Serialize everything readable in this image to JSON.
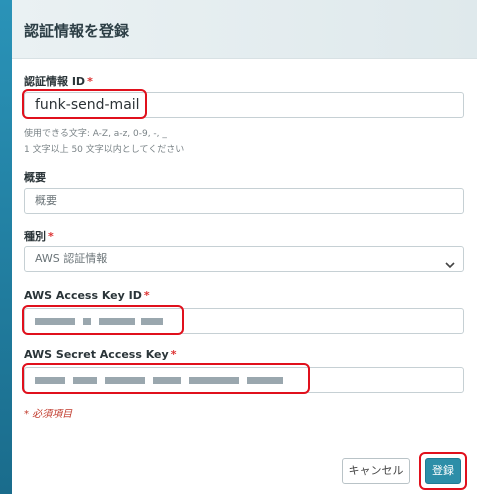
{
  "dialog": {
    "title": "認証情報を登録"
  },
  "credential_id": {
    "label": "認証情報 ID",
    "required_mark": "*",
    "value": "funk-send-mail",
    "hint_chars": "使用できる文字: A-Z, a-z, 0-9, -, _",
    "hint_length": "1 文字以上 50 文字以内としてください"
  },
  "summary": {
    "label": "概要",
    "placeholder": "概要"
  },
  "type": {
    "label": "種別",
    "required_mark": "*",
    "selected": "AWS 認証情報"
  },
  "access_key_id": {
    "label": "AWS Access Key ID",
    "required_mark": "*"
  },
  "secret_access_key": {
    "label": "AWS Secret Access Key",
    "required_mark": "*"
  },
  "required_note": "* 必須項目",
  "buttons": {
    "cancel": "キャンセル",
    "submit": "登録"
  },
  "icons": {
    "select_chevron": "chevron-down-icon"
  },
  "colors": {
    "accent": "#2d8ea8",
    "highlight": "#e0101c",
    "required": "#d33333"
  }
}
